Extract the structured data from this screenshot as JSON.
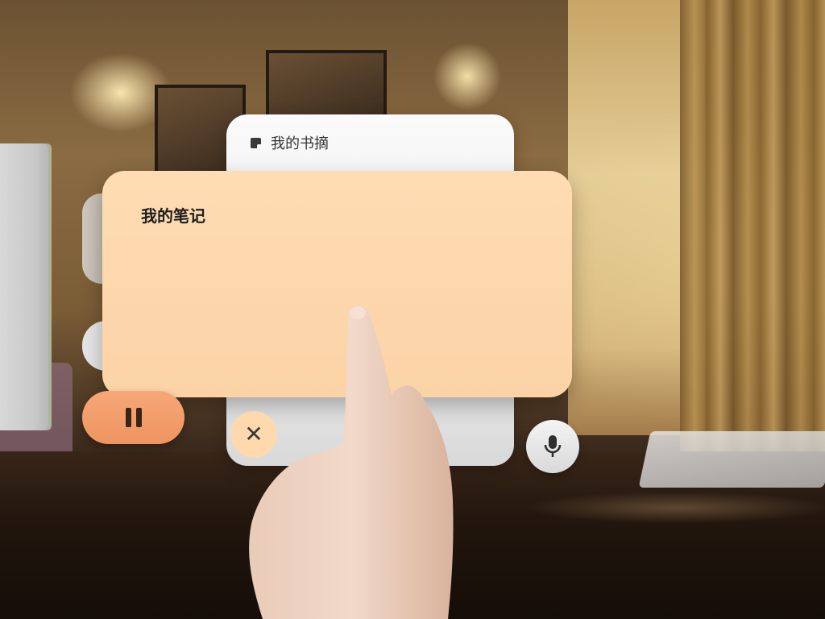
{
  "back_card": {
    "title": "我的书摘",
    "icon": "note-icon"
  },
  "front_card": {
    "title": "我的笔记",
    "background": "#fcd8ad"
  },
  "controls": {
    "pause_icon": "pause-icon",
    "close_icon": "close-icon",
    "close_glyph": "✕",
    "mic_icon": "microphone-icon",
    "accent": "#ef9a66"
  }
}
